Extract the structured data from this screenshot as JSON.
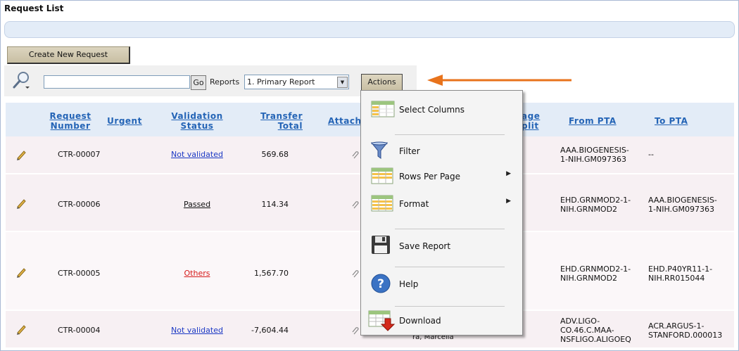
{
  "region_title": "Request List",
  "create_button": "Create New Request",
  "search": {
    "value": "",
    "go": "Go"
  },
  "reports": {
    "label": "Reports",
    "selected": "1. Primary Report"
  },
  "actions_button": "Actions",
  "columns": {
    "request_number": [
      "Request",
      "Number"
    ],
    "urgent": "Urgent",
    "validation_status": [
      "Validation",
      "Status"
    ],
    "transfer_total": [
      "Transfer",
      "Total"
    ],
    "attach": "Attach",
    "percentage_split": [
      "age",
      "plit"
    ],
    "from_pta": "From PTA",
    "to_pta": "To PTA"
  },
  "rows": [
    {
      "request_number": "CTR-00007",
      "status": "Not validated",
      "status_color": "#1b38c4",
      "transfer_total": "569.68",
      "from_pta": [
        "AAA.BIOGENESIS-",
        "1-NIH.GM097363"
      ],
      "to_pta": [
        "--"
      ]
    },
    {
      "request_number": "CTR-00006",
      "status": "Passed",
      "status_color": "#111111",
      "transfer_total": "114.34",
      "from_pta": [
        "EHD.GRNMOD2-1-",
        "NIH.GRNMOD2"
      ],
      "to_pta": [
        "AAA.BIOGENESIS-",
        "1-NIH.GM097363"
      ]
    },
    {
      "request_number": "CTR-00005",
      "status": "Others",
      "status_color": "#d61a1a",
      "transfer_total": "1,567.70",
      "from_pta": [
        "EHD.GRNMOD2-1-",
        "NIH.GRNMOD2"
      ],
      "to_pta": [
        "EHD.P40YR11-1-",
        "NIH.RR015044"
      ]
    },
    {
      "request_number": "CTR-00004",
      "status": "Not validated",
      "status_color": "#1b38c4",
      "transfer_total": "-7,604.44",
      "from_pta": [
        "ADV.LIGO-",
        "CO.46.C.MAA-",
        "NSFLIGO.ALIGOEQ"
      ],
      "to_pta": [
        "ACR.ARGUS-1-",
        "STANFORD.000013"
      ],
      "partial_text": "ra, Marcella"
    }
  ],
  "actions_menu": {
    "select_columns": "Select Columns",
    "filter": "Filter",
    "rows_per_page": "Rows Per Page",
    "format": "Format",
    "save_report": "Save Report",
    "help": "Help",
    "download": "Download"
  },
  "colors": {
    "header_bg": "#e3ecf7",
    "row_alt_bg": "#f7f0f3",
    "link_blue": "#2464b6",
    "annotation_arrow": "#e8731c"
  },
  "icons": [
    "search-icon",
    "pencil-icon",
    "paperclip-icon",
    "select-columns-icon",
    "filter-icon",
    "rows-per-page-icon",
    "format-icon",
    "save-icon",
    "help-icon",
    "download-icon",
    "annotation-arrow"
  ]
}
